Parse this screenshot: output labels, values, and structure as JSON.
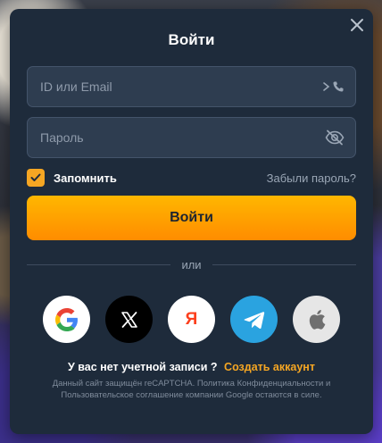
{
  "modal": {
    "title": "Войти",
    "close_icon": "close-icon"
  },
  "login_field": {
    "placeholder": "ID или Email",
    "icons": [
      "chevron-right-icon",
      "phone-icon"
    ]
  },
  "password_field": {
    "placeholder": "Пароль",
    "icon": "eye-off-icon"
  },
  "remember": {
    "label": "Запомнить",
    "checked": true
  },
  "forgot_link": "Забыли пароль?",
  "login_button": "Войти",
  "divider_text": "или",
  "social_logins": [
    {
      "name": "google",
      "icon": "google-icon"
    },
    {
      "name": "x",
      "icon": "x-icon"
    },
    {
      "name": "yandex",
      "icon": "yandex-icon",
      "glyph": "Я"
    },
    {
      "name": "telegram",
      "icon": "telegram-icon"
    },
    {
      "name": "apple",
      "icon": "apple-icon"
    }
  ],
  "register": {
    "question": "У вас нет учетной записи ?",
    "link": "Создать аккаунт"
  },
  "recaptcha_text": "Данный сайт защищён reCAPTCHA. Политика Конфиденциальности и Пользовательское соглашение компании Google остаются в силе.",
  "colors": {
    "accent": "#f5a623",
    "modal_bg": "#1e2b3b",
    "field_bg": "#2e3d50",
    "telegram": "#2aa3e0"
  }
}
